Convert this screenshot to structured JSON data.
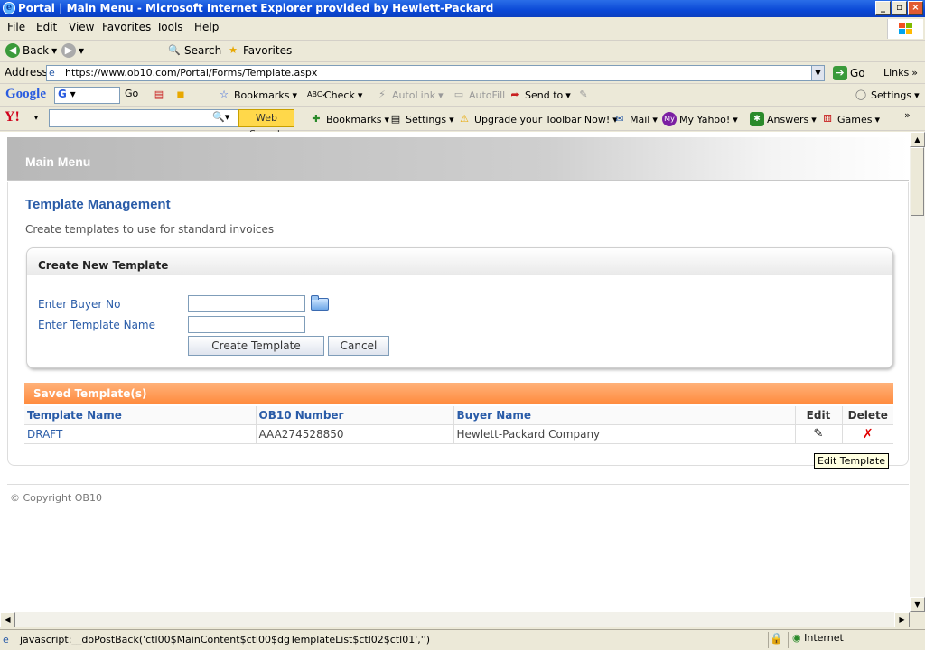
{
  "window": {
    "title": "Portal | Main Menu - Microsoft Internet Explorer provided by Hewlett-Packard"
  },
  "menu": [
    "File",
    "Edit",
    "View",
    "Favorites",
    "Tools",
    "Help"
  ],
  "toolbar": {
    "back": "Back",
    "search": "Search",
    "favorites": "Favorites"
  },
  "address": {
    "label": "Address",
    "url": "https://www.ob10.com/Portal/Forms/Template.aspx",
    "go": "Go",
    "links": "Links"
  },
  "google_bar": {
    "logo": "Google",
    "input_value": "G",
    "go": "Go",
    "bookmarks": "Bookmarks",
    "check": "Check",
    "autolink": "AutoLink",
    "autofill": "AutoFill",
    "send_to": "Send to",
    "settings": "Settings"
  },
  "yahoo_bar": {
    "logo": "Y!",
    "web_search": "Web Search",
    "bookmarks": "Bookmarks",
    "settings": "Settings",
    "upgrade": "Upgrade your Toolbar Now!",
    "mail": "Mail",
    "my_yahoo": "My Yahoo!",
    "answers": "Answers",
    "games": "Games"
  },
  "page": {
    "header": "Main Menu",
    "title": "Template Management",
    "subtitle": "Create templates to use for standard invoices",
    "create_box": {
      "heading": "Create New Template",
      "buyer_label": "Enter Buyer No",
      "buyer_value": "",
      "template_label": "Enter Template Name",
      "template_value": "",
      "create_button": "Create Template",
      "cancel_button": "Cancel"
    },
    "saved": {
      "heading": "Saved Template(s)",
      "columns": [
        "Template Name",
        "OB10 Number",
        "Buyer Name",
        "Edit",
        "Delete"
      ],
      "rows": [
        {
          "name": "DRAFT",
          "ob10": "AAA274528850",
          "buyer": "Hewlett-Packard Company"
        }
      ]
    },
    "tooltip": "Edit Template",
    "copyright": "© Copyright OB10"
  },
  "status": {
    "text": "javascript:__doPostBack('ctl00$MainContent$ctl00$dgTemplateList$ctl02$ctl01','')",
    "zone": "Internet"
  }
}
